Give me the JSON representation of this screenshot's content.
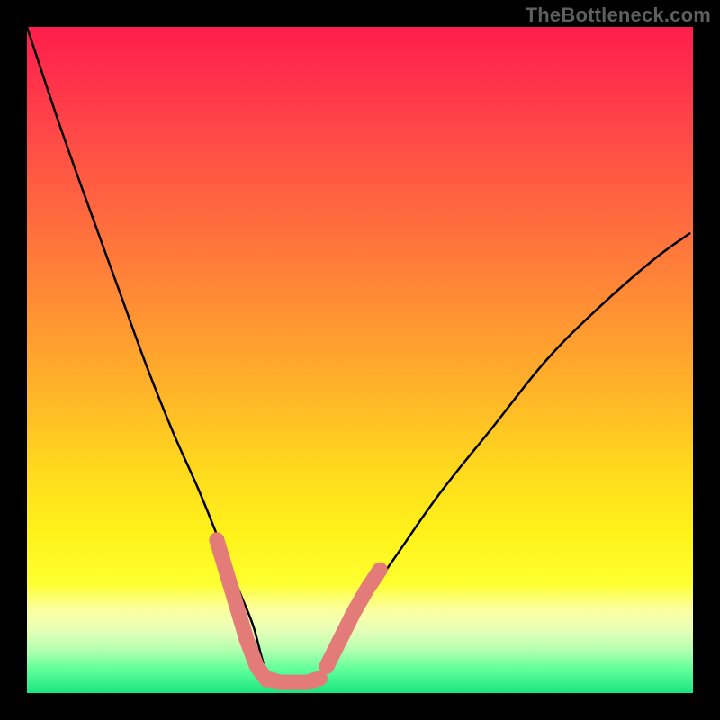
{
  "watermark": "TheBottleneck.com",
  "chart_data": {
    "type": "line",
    "title": "",
    "xlabel": "",
    "ylabel": "",
    "xlim": [
      0,
      100
    ],
    "ylim": [
      0,
      100
    ],
    "grid": false,
    "legend": false,
    "series": [
      {
        "name": "bottleneck-curve",
        "x": [
          0,
          5,
          10,
          14,
          18,
          22,
          26,
          30,
          32,
          34,
          36,
          38,
          40,
          42,
          44,
          48,
          55,
          62,
          70,
          78,
          86,
          94,
          99.5
        ],
        "values": [
          100,
          85,
          71,
          60,
          49,
          39,
          30,
          20,
          15,
          10,
          3,
          1.5,
          1.5,
          1.5,
          3,
          10,
          20,
          30,
          40,
          50,
          58,
          65,
          69
        ]
      }
    ],
    "highlight_segments": [
      {
        "name": "left-marker-band",
        "x": [
          28.5,
          30,
          31.5,
          33,
          34.5,
          36
        ],
        "values": [
          23,
          18,
          13,
          8,
          4,
          2
        ]
      },
      {
        "name": "valley-floor",
        "x": [
          36,
          38,
          40,
          42,
          44
        ],
        "values": [
          2.2,
          1.6,
          1.6,
          1.6,
          2.2
        ]
      },
      {
        "name": "right-marker-band",
        "x": [
          45,
          47,
          49,
          51,
          53
        ],
        "values": [
          4,
          8,
          12,
          15.5,
          18.5
        ]
      }
    ],
    "gradient_stops": [
      {
        "offset": 0.0,
        "color": "#ff1e4b"
      },
      {
        "offset": 0.07,
        "color": "#ff2f4c"
      },
      {
        "offset": 0.18,
        "color": "#ff4e46"
      },
      {
        "offset": 0.3,
        "color": "#ff6e3e"
      },
      {
        "offset": 0.42,
        "color": "#ff8f34"
      },
      {
        "offset": 0.55,
        "color": "#ffb528"
      },
      {
        "offset": 0.66,
        "color": "#ffd81e"
      },
      {
        "offset": 0.76,
        "color": "#fff21a"
      },
      {
        "offset": 0.835,
        "color": "#ffff30"
      },
      {
        "offset": 0.875,
        "color": "#fcffa0"
      },
      {
        "offset": 0.905,
        "color": "#e8ffb8"
      },
      {
        "offset": 0.935,
        "color": "#b4ffb0"
      },
      {
        "offset": 0.965,
        "color": "#5fff9a"
      },
      {
        "offset": 1.0,
        "color": "#19e580"
      }
    ],
    "colors": {
      "curve": "#000000",
      "highlight": "#e37c79",
      "background": "#000000"
    }
  }
}
